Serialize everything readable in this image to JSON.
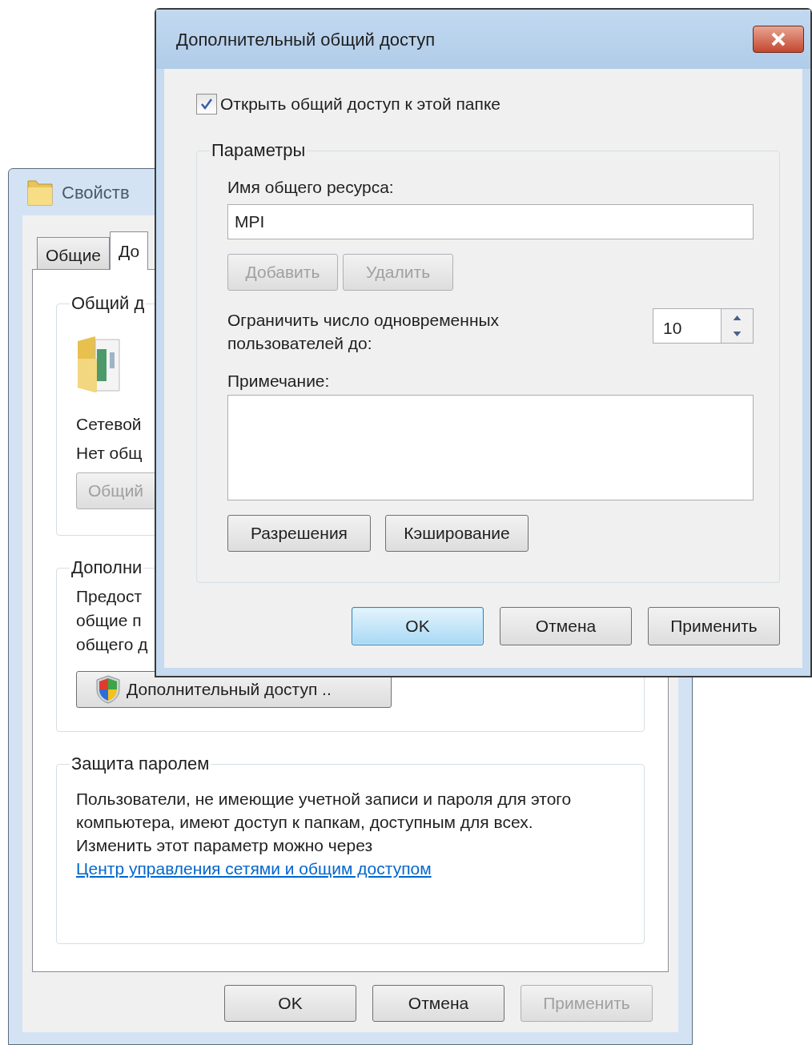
{
  "back_window": {
    "title": "Свойств",
    "tabs": [
      {
        "label": "Общие",
        "selected": false
      },
      {
        "label": "До",
        "selected": true
      }
    ],
    "sharing_group": {
      "title": "Общий д",
      "lines": [
        "Сетевой",
        "Нет общ"
      ],
      "button": {
        "label": "Общий",
        "disabled": true
      }
    },
    "advanced_group": {
      "title": "Дополни",
      "lines": [
        "Предост",
        "общие п",
        "общего д"
      ],
      "button": {
        "label": "Дополнительный доступ ..",
        "disabled": false
      }
    },
    "password_group": {
      "title": "Защита паролем",
      "text": "Пользователи, не имеющие учетной записи и пароля для этого компьютера, имеют доступ к папкам, доступным для всех.",
      "note": "Изменить этот параметр можно через",
      "link": "Центр управления сетями и общим доступом"
    },
    "buttons": [
      {
        "label": "OK",
        "disabled": false
      },
      {
        "label": "Отмена",
        "disabled": false
      },
      {
        "label": "Применить",
        "disabled": true
      }
    ]
  },
  "dialog": {
    "title": "Дополнительный общий доступ",
    "share_checkbox": {
      "label": "Открыть общий доступ к этой папке",
      "checked": true
    },
    "group_title": "Параметры",
    "share_name": {
      "label": "Имя общего ресурса:",
      "value": "MPI"
    },
    "name_buttons": [
      {
        "label": "Добавить",
        "disabled": true
      },
      {
        "label": "Удалить",
        "disabled": true
      }
    ],
    "limit": {
      "label": "Ограничить число одновременных пользователей до:",
      "value": "10"
    },
    "comment": {
      "label": "Примечание:"
    },
    "option_buttons": [
      {
        "label": "Разрешения",
        "disabled": false
      },
      {
        "label": "Кэширование",
        "disabled": false
      }
    ],
    "buttons": [
      {
        "label": "OK",
        "default": true,
        "disabled": false
      },
      {
        "label": "Отмена",
        "default": false,
        "disabled": false
      },
      {
        "label": "Применить",
        "default": false,
        "disabled": false
      }
    ]
  }
}
